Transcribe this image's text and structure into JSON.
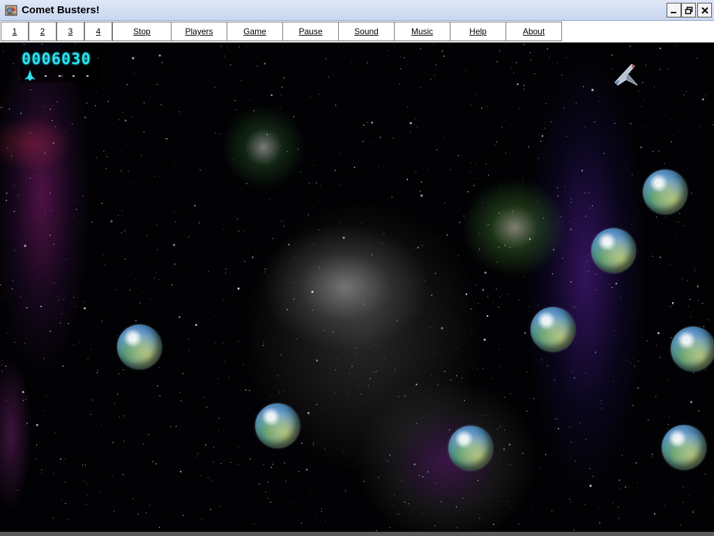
{
  "window": {
    "title": "Comet Busters!",
    "controls": {
      "minimize": "_",
      "restore": "🗗",
      "close": "✕"
    }
  },
  "menu": {
    "items": [
      {
        "label": "1"
      },
      {
        "label": "2"
      },
      {
        "label": "3"
      },
      {
        "label": "4"
      },
      {
        "label": "Stop"
      },
      {
        "label": "Players"
      },
      {
        "label": "Game"
      },
      {
        "label": "Pause"
      },
      {
        "label": "Sound"
      },
      {
        "label": "Music"
      },
      {
        "label": "Help"
      },
      {
        "label": "About"
      }
    ]
  },
  "hud": {
    "score": "0006030",
    "score_color": "#2ee0f0",
    "reserve_lives_markers": 4
  },
  "game": {
    "comet_count": 10,
    "player_ship_icon": "spaceship-icon"
  }
}
